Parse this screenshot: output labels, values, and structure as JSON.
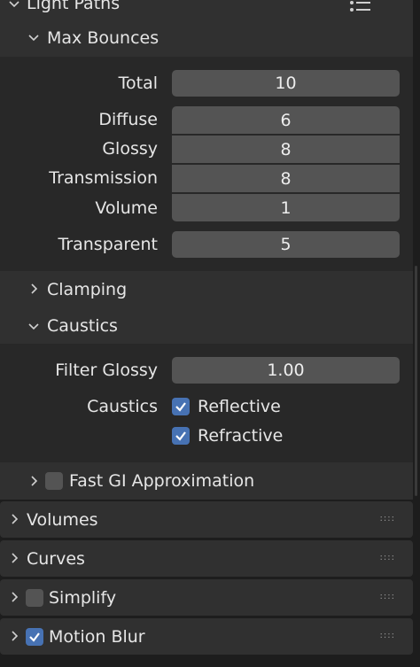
{
  "light_paths": {
    "title": "Light Paths"
  },
  "max_bounces": {
    "title": "Max Bounces",
    "total": {
      "label": "Total",
      "value": "10"
    },
    "diffuse": {
      "label": "Diffuse",
      "value": "6"
    },
    "glossy": {
      "label": "Glossy",
      "value": "8"
    },
    "transmission": {
      "label": "Transmission",
      "value": "8"
    },
    "volume": {
      "label": "Volume",
      "value": "1"
    },
    "transparent": {
      "label": "Transparent",
      "value": "5"
    }
  },
  "clamping": {
    "title": "Clamping"
  },
  "caustics": {
    "title": "Caustics",
    "filter_glossy": {
      "label": "Filter Glossy",
      "value": "1.00"
    },
    "caustics_label": "Caustics",
    "reflective": {
      "label": "Reflective",
      "checked": true
    },
    "refractive": {
      "label": "Refractive",
      "checked": true
    }
  },
  "fast_gi": {
    "label": "Fast GI Approximation",
    "checked": false
  },
  "panels": {
    "volumes": "Volumes",
    "curves": "Curves",
    "simplify": {
      "label": "Simplify",
      "checked": false
    },
    "motion_blur": {
      "label": "Motion Blur",
      "checked": true
    },
    "grip_glyph": "::::"
  },
  "colors": {
    "accent": "#4772b3",
    "field": "#545454",
    "panel": "#303030",
    "subpanel": "#282828"
  }
}
